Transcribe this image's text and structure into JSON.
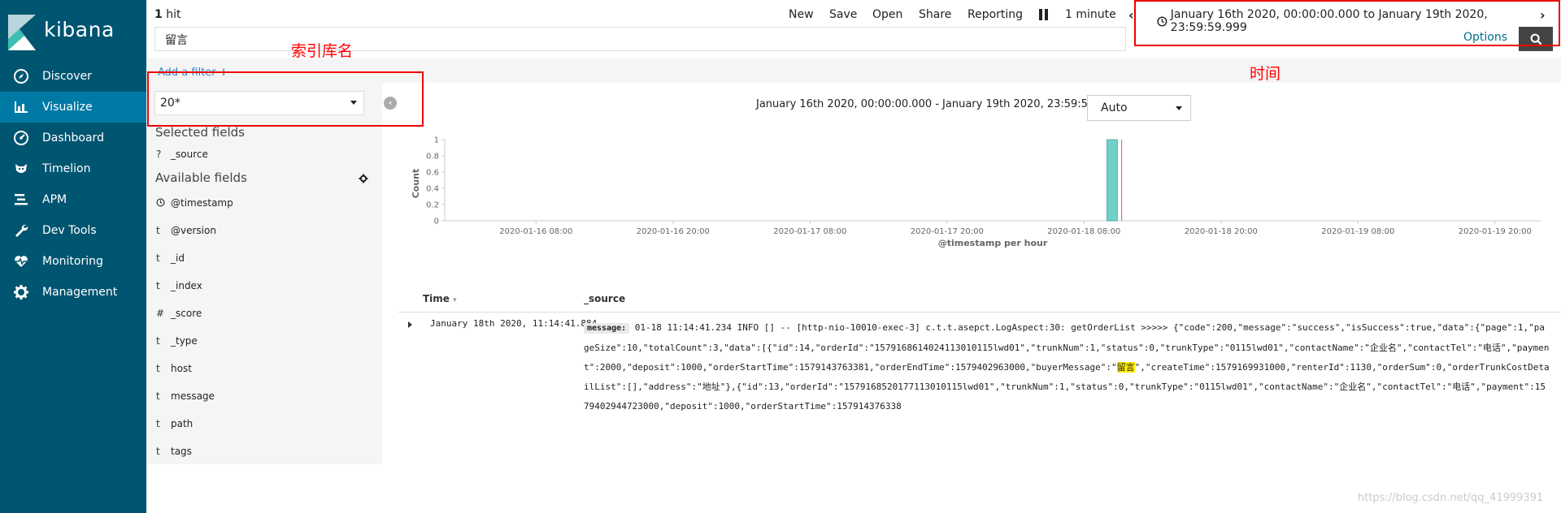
{
  "nav": {
    "logo_text": "kibana",
    "items": [
      {
        "label": "Discover",
        "icon": "compass-icon"
      },
      {
        "label": "Visualize",
        "icon": "bar-chart-icon"
      },
      {
        "label": "Dashboard",
        "icon": "dashboard-icon"
      },
      {
        "label": "Timelion",
        "icon": "timelion-icon"
      },
      {
        "label": "APM",
        "icon": "apm-icon"
      },
      {
        "label": "Dev Tools",
        "icon": "wrench-icon"
      },
      {
        "label": "Monitoring",
        "icon": "heartbeat-icon"
      },
      {
        "label": "Management",
        "icon": "gear-icon"
      }
    ],
    "active": "Visualize"
  },
  "toolbar": {
    "hits_count": "1",
    "hits_label": "hit",
    "menu": [
      "New",
      "Save",
      "Open",
      "Share",
      "Reporting"
    ],
    "refresh_interval": "1 minute",
    "time_range": "January 16th 2020, 00:00:00.000 to January 19th 2020, 23:59:59.999",
    "options_label": "Options"
  },
  "search": {
    "query": "留言"
  },
  "filter": {
    "add_filter_label": "Add a filter",
    "add_filter_icon": "plus-icon"
  },
  "sidebar": {
    "index_pattern": "20*",
    "selected_title": "Selected fields",
    "selected_fields": [
      {
        "type": "?",
        "name": "_source"
      }
    ],
    "available_title": "Available fields",
    "available_fields": [
      {
        "type": "clock",
        "name": "@timestamp"
      },
      {
        "type": "t",
        "name": "@version"
      },
      {
        "type": "t",
        "name": "_id"
      },
      {
        "type": "t",
        "name": "_index"
      },
      {
        "type": "#",
        "name": "_score"
      },
      {
        "type": "t",
        "name": "_type"
      },
      {
        "type": "t",
        "name": "host"
      },
      {
        "type": "t",
        "name": "message"
      },
      {
        "type": "t",
        "name": "path"
      },
      {
        "type": "t",
        "name": "tags"
      }
    ]
  },
  "chart_header": {
    "range": "January 16th 2020, 00:00:00.000 - January 19th 2020, 23:59:59.999 —",
    "interval": "Auto"
  },
  "chart_data": {
    "type": "bar",
    "x_type": "datetime",
    "x_start": "2020-01-16 00:00",
    "x_end": "2020-01-20 00:00",
    "interval": "1 hour",
    "xlabel": "@timestamp per hour",
    "ylabel": "Count",
    "ylim": [
      0,
      1
    ],
    "y_ticks": [
      0,
      0.2,
      0.4,
      0.6,
      0.8,
      1
    ],
    "x_ticks": [
      "2020-01-16 08:00",
      "2020-01-16 20:00",
      "2020-01-17 08:00",
      "2020-01-17 20:00",
      "2020-01-18 08:00",
      "2020-01-18 20:00",
      "2020-01-19 08:00",
      "2020-01-19 20:00"
    ],
    "bars": [
      {
        "x": "2020-01-18 10:00",
        "value": 1
      }
    ],
    "current_time_marker": "2020-01-18 11:00",
    "bar_color": "#6fd1c8",
    "marker_color": "#e05a5a",
    "grid": false
  },
  "table": {
    "col_time": "Time",
    "col_source": "_source",
    "rows": [
      {
        "time": "January 18th 2020, 11:14:41.884",
        "source_key": "message:",
        "source_pre": "01-18 11:14:41.234 INFO [] -- [http-nio-10010-exec-3] c.t.t.asepct.LogAspect:30: getOrderList >>>>> {\"code\":200,\"message\":\"success\",\"isSuccess\":true,\"data\":{\"page\":1,\"pageSize\":10,\"totalCount\":3,\"data\":[{\"id\":14,\"orderId\":\"1579168614024113010115lwd01\",\"trunkNum\":1,\"status\":0,\"trunkType\":\"0115lwd01\",\"contactName\":\"企业名\",\"contactTel\":\"电话\",\"payment\":2000,\"deposit\":1000,\"orderStartTime\":1579143763381,\"orderEndTime\":1579402963000,\"buyerMessage\":\"",
        "source_highlight": "留言",
        "source_post": "\",\"createTime\":1579169931000,\"renterId\":1130,\"orderSum\":0,\"orderTrunkCostDetailList\":[],\"address\":\"地址\"},{\"id\":13,\"orderId\":\"1579168520177113010115lwd01\",\"trunkNum\":1,\"status\":0,\"trunkType\":\"0115lwd01\",\"contactName\":\"企业名\",\"contactTel\":\"电话\",\"payment\":1579402944723000,\"deposit\":1000,\"orderStartTime\":157914376338"
      }
    ]
  },
  "annotations": {
    "index_label": "索引库名",
    "time_label": "时间",
    "color": "#ff0000"
  },
  "watermark": "https://blog.csdn.net/qq_41999391"
}
